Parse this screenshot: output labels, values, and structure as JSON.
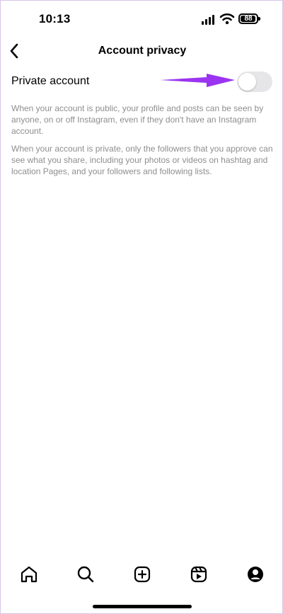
{
  "status_bar": {
    "time": "10:13",
    "battery_level": "88",
    "icons": [
      "signal-icon",
      "wifi-icon",
      "battery-icon"
    ]
  },
  "header": {
    "title": "Account privacy",
    "back_icon": "chevron-left-icon"
  },
  "setting": {
    "label": "Private account",
    "toggle_on": false,
    "annotation_icon": "arrow-icon",
    "annotation_color": "#9b34f0"
  },
  "descriptions": [
    "When your account is public, your profile and posts can be seen by anyone, on or off Instagram, even if they don't have an Instagram account.",
    "When your account is private, only the followers that you approve can see what you share, including your photos or videos on hashtag and location Pages, and your followers and following lists."
  ],
  "bottom_nav": {
    "items": [
      {
        "icon": "home-icon"
      },
      {
        "icon": "search-icon"
      },
      {
        "icon": "create-icon"
      },
      {
        "icon": "reels-icon"
      },
      {
        "icon": "profile-icon"
      }
    ]
  },
  "colors": {
    "background": "#ffffff",
    "text": "#000000",
    "muted_text": "#8e8e8e",
    "toggle_off": "#e6e6e9",
    "annotation": "#9b34f0"
  }
}
